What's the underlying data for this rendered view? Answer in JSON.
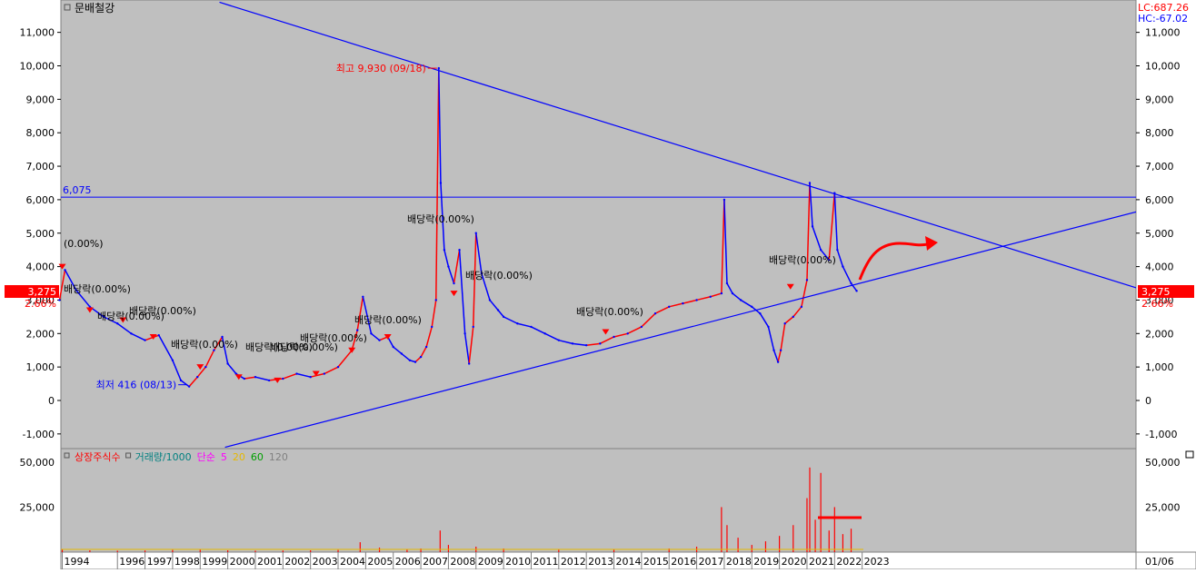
{
  "panel": {
    "title": "문배철강",
    "lc_label": "LC:687.26",
    "hc_label": "HC:-67.02",
    "current_price_label": "3,275",
    "current_change_label": "2.66%",
    "hline_label": "6,075",
    "high_annotation": "최고 9,930 (09/18)",
    "low_annotation": "최저 416 (08/13)"
  },
  "colors": {
    "background": "#bfbfbf",
    "trendline": "#0000ff",
    "price_up": "#ff0000",
    "price_down": "#0000ff",
    "annotation_red": "#ff0000",
    "annotation_blue": "#0000ff",
    "dividend_marker": "#ff0000",
    "current_price_bg": "#ff0000"
  },
  "volume_panel": {
    "legend": [
      {
        "label": "상장주식수",
        "color": "#ff0000"
      },
      {
        "label": "거래량/1000",
        "color": "#008080"
      },
      {
        "label": "단순",
        "color": "#ff00ff"
      },
      {
        "label": "5",
        "color": "#ff00ff"
      },
      {
        "label": "20",
        "color": "#e6b800"
      },
      {
        "label": "60",
        "color": "#00a000"
      },
      {
        "label": "120",
        "color": "#808080"
      }
    ]
  },
  "dividend_labels": [
    {
      "text": "(0.00%)"
    },
    {
      "text": "배당락(0.00%)"
    },
    {
      "text": "배당락(0.00%)"
    },
    {
      "text": "배당락(0.00%)"
    },
    {
      "text": "배당락(0.00%)"
    },
    {
      "text": "배당락(0.00%)"
    },
    {
      "text": "배당락(0.00%)"
    },
    {
      "text": "배당락(0.00%)"
    },
    {
      "text": "배당락(0.00%)"
    },
    {
      "text": "배당락(0.00%)"
    },
    {
      "text": "배당락(0.00%)"
    },
    {
      "text": "배당락(0.00%)"
    },
    {
      "text": "배당락(0.00%)"
    }
  ],
  "x_date_label": "01/06",
  "chart_data": [
    {
      "type": "line",
      "title": "문배철강",
      "x_tick_labels": [
        "1994",
        "1996",
        "1997",
        "1998",
        "1999",
        "2000",
        "2001",
        "2002",
        "2003",
        "2004",
        "2005",
        "2006",
        "2007",
        "2008",
        "2009",
        "2010",
        "2011",
        "2012",
        "2013",
        "2014",
        "2015",
        "2016",
        "2017",
        "2018",
        "2019",
        "2020",
        "2021",
        "2022",
        "2023"
      ],
      "y_tick_labels": [
        "-1,000",
        "0",
        "1,000",
        "2,000",
        "3,000",
        "4,000",
        "5,000",
        "6,000",
        "7,000",
        "8,000",
        "9,000",
        "10,000",
        "11,000"
      ],
      "ylim": [
        -1300,
        11800
      ],
      "grid": false,
      "series": [
        {
          "x": [
            1993.9,
            1994.1,
            1994.5,
            1995.0,
            1995.5,
            1996.0,
            1996.5,
            1997.0,
            1997.5,
            1998.0,
            1998.3,
            1998.6,
            1998.9,
            1999.2,
            1999.5,
            1999.8,
            2000.0,
            2000.3,
            2000.6,
            2001.0,
            2001.5,
            2002.0,
            2002.5,
            2003.0,
            2003.5,
            2004.0,
            2004.5,
            2004.7,
            2004.9,
            2005.2,
            2005.5,
            2005.8,
            2006.0,
            2006.3,
            2006.6,
            2006.8,
            2007.0,
            2007.2,
            2007.4,
            2007.55,
            2007.65,
            2007.72,
            2007.85,
            2008.0,
            2008.2,
            2008.4,
            2008.6,
            2008.75,
            2008.9,
            2009.0,
            2009.2,
            2009.5,
            2009.8,
            2010.0,
            2010.5,
            2011.0,
            2011.5,
            2012.0,
            2012.5,
            2013.0,
            2013.5,
            2014.0,
            2014.5,
            2015.0,
            2015.5,
            2016.0,
            2016.5,
            2017.0,
            2017.5,
            2017.9,
            2018.0,
            2018.1,
            2018.3,
            2018.6,
            2019.0,
            2019.3,
            2019.6,
            2019.8,
            2019.95,
            2020.05,
            2020.2,
            2020.5,
            2020.8,
            2021.0,
            2021.1,
            2021.2,
            2021.5,
            2021.8,
            2022.0,
            2022.1,
            2022.3,
            2022.6,
            2022.8
          ],
          "values": [
            3000,
            3900,
            3300,
            2800,
            2500,
            2300,
            2000,
            1800,
            1950,
            1200,
            600,
            416,
            700,
            1000,
            1500,
            1900,
            1100,
            800,
            650,
            700,
            600,
            650,
            800,
            700,
            800,
            1000,
            1500,
            2100,
            3100,
            2000,
            1800,
            1900,
            1600,
            1400,
            1200,
            1150,
            1300,
            1600,
            2200,
            3000,
            9930,
            6500,
            4500,
            4000,
            3500,
            4500,
            2000,
            1100,
            2200,
            5000,
            3800,
            3000,
            2700,
            2500,
            2300,
            2200,
            2000,
            1800,
            1700,
            1650,
            1700,
            1900,
            2000,
            2200,
            2600,
            2800,
            2900,
            3000,
            3100,
            3200,
            6000,
            3500,
            3200,
            3000,
            2800,
            2600,
            2200,
            1500,
            1150,
            1500,
            2300,
            2500,
            2800,
            3600,
            6500,
            5200,
            4500,
            4200,
            6200,
            4500,
            4000,
            3500,
            3275
          ]
        }
      ],
      "horizontal_line": 6075,
      "trendlines": [
        {
          "x": [
            1999.7,
            2033.0
          ],
          "y": [
            11900,
            3350
          ]
        },
        {
          "x": [
            1999.9,
            2033.0
          ],
          "y": [
            -1400,
            5650
          ]
        }
      ],
      "annotations": [
        {
          "text": "최고 9,930 (09/18)",
          "x": 2007.65,
          "y": 9930
        },
        {
          "text": "최저 416 (08/13)",
          "x": 1998.6,
          "y": 416
        }
      ]
    },
    {
      "type": "bar",
      "title": "",
      "y_tick_labels": [
        "25,000",
        "50,000"
      ],
      "ylim": [
        0,
        57500
      ],
      "series": [
        {
          "name": "거래량/1000",
          "x": [
            1994.0,
            1995.0,
            1996.0,
            1997.0,
            1998.0,
            1999.0,
            2000.0,
            2001.0,
            2002.0,
            2003.0,
            2004.0,
            2004.8,
            2005.5,
            2006.5,
            2007.0,
            2007.7,
            2008.0,
            2009.0,
            2010.0,
            2012.0,
            2014.0,
            2016.0,
            2017.0,
            2017.9,
            2018.1,
            2018.5,
            2019.0,
            2019.5,
            2020.0,
            2020.5,
            2021.0,
            2021.1,
            2021.3,
            2021.5,
            2021.8,
            2022.0,
            2022.3,
            2022.6
          ],
          "values": [
            1500,
            1000,
            800,
            900,
            1200,
            1500,
            1000,
            800,
            900,
            1000,
            1200,
            5500,
            2500,
            1500,
            2000,
            12000,
            4000,
            3000,
            2000,
            1500,
            1500,
            2000,
            3000,
            25000,
            15000,
            8000,
            4000,
            6000,
            9000,
            15000,
            30000,
            47000,
            18000,
            44000,
            12000,
            25000,
            10000,
            13000
          ]
        }
      ]
    }
  ]
}
